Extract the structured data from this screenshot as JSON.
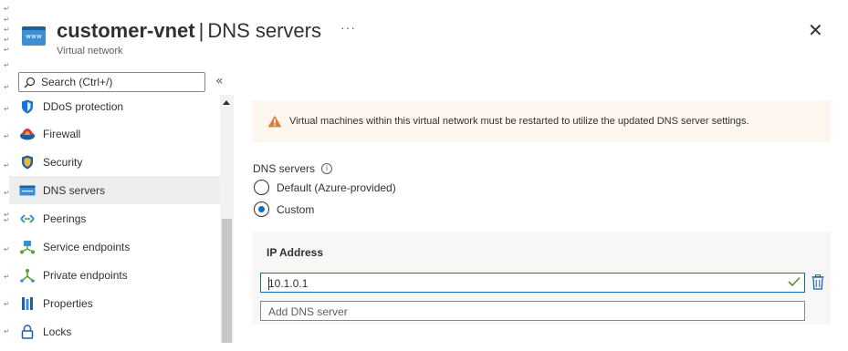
{
  "header": {
    "title": "customer-vnet",
    "separator": "|",
    "section": "DNS servers",
    "subtitle": "Virtual network",
    "more_label": "···",
    "close_label": "✕",
    "icon": "virtual-network-icon",
    "icon_text": "www"
  },
  "search": {
    "placeholder": "Search (Ctrl+/)",
    "collapse_label": "«"
  },
  "sidebar": {
    "items": [
      {
        "label": "DDoS protection",
        "icon": "shield-icon"
      },
      {
        "label": "Firewall",
        "icon": "firewall-icon"
      },
      {
        "label": "Security",
        "icon": "security-icon"
      },
      {
        "label": "DNS servers",
        "icon": "dns-servers-icon",
        "active": true
      },
      {
        "label": "Peerings",
        "icon": "peerings-icon"
      },
      {
        "label": "Service endpoints",
        "icon": "service-endpoints-icon"
      },
      {
        "label": "Private endpoints",
        "icon": "private-endpoints-icon"
      },
      {
        "label": "Properties",
        "icon": "properties-icon"
      },
      {
        "label": "Locks",
        "icon": "lock-icon"
      }
    ]
  },
  "banner": {
    "text": "Virtual machines within this virtual network must be restarted to utilize the updated DNS server settings.",
    "icon": "warning-icon"
  },
  "dns": {
    "label": "DNS servers",
    "info_label": "i",
    "options": [
      {
        "label": "Default (Azure-provided)",
        "selected": false
      },
      {
        "label": "Custom",
        "selected": true
      }
    ]
  },
  "ip_table": {
    "header": "IP Address",
    "values": [
      "10.1.0.1"
    ],
    "add_placeholder": "Add DNS server"
  },
  "colors": {
    "accent": "#0f6cbd",
    "warning": "#d67f3c",
    "valid": "#5a8f2b",
    "active_row": "#ededed"
  }
}
